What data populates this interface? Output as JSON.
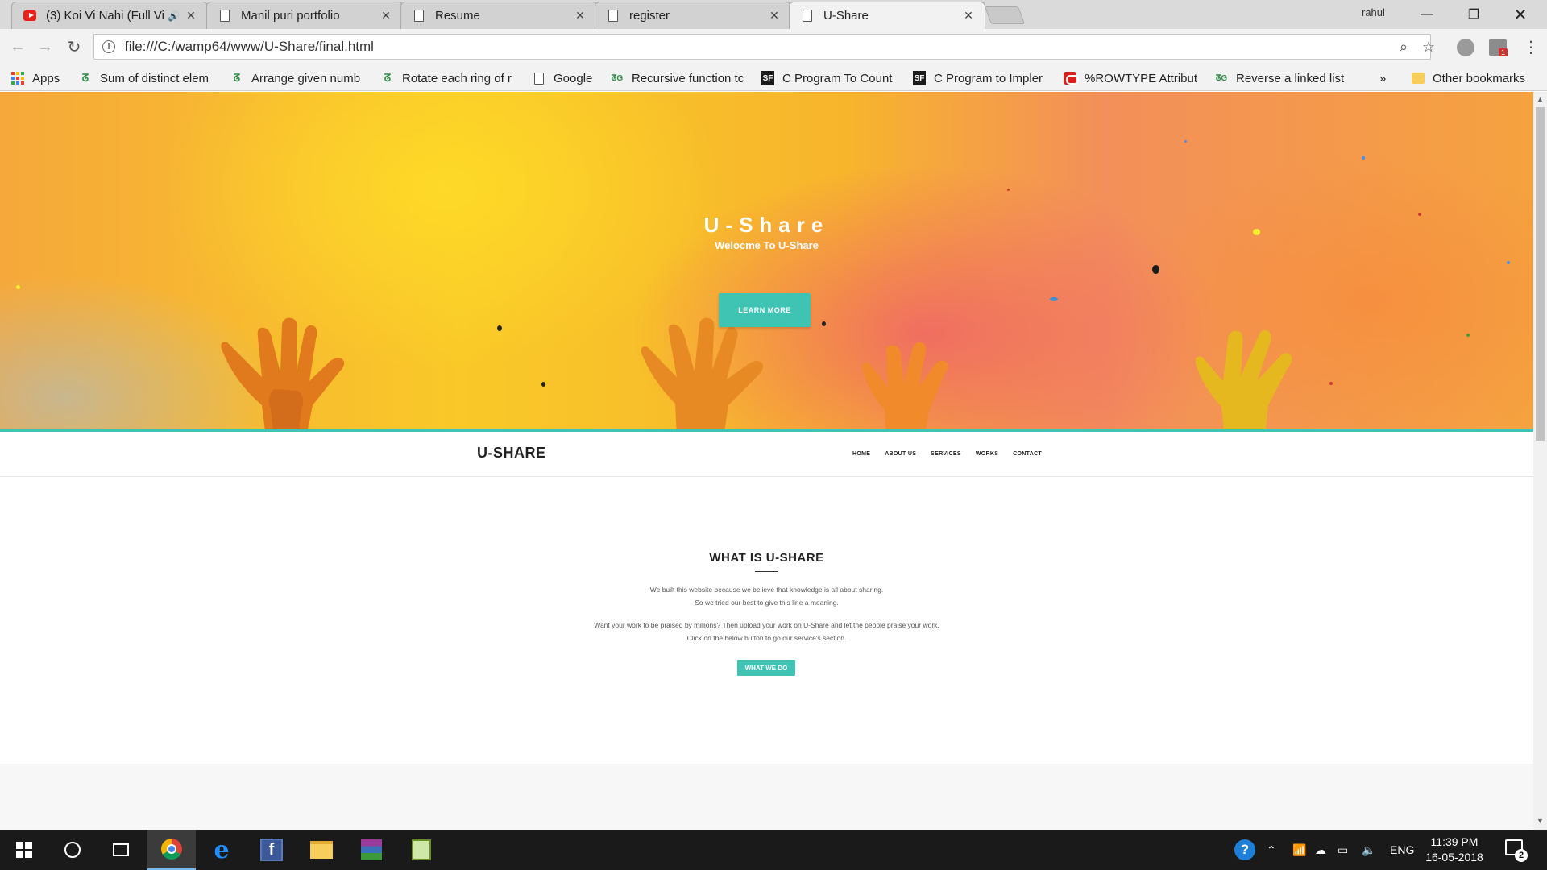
{
  "browser": {
    "tabs": [
      {
        "title": "(3) Koi Vi Nahi (Full Vi",
        "icon": "youtube-icon",
        "audio": "🔊"
      },
      {
        "title": "Manil puri portfolio",
        "icon": "page-icon"
      },
      {
        "title": "Resume",
        "icon": "page-icon"
      },
      {
        "title": "register",
        "icon": "page-icon"
      },
      {
        "title": "U-Share",
        "icon": "page-icon",
        "active": true
      }
    ],
    "profile_name": "rahul",
    "url": "file:///C:/wamp64/www/U-Share/final.html",
    "bookmarks": [
      {
        "label": "Apps",
        "icon": "apps-grid-icon"
      },
      {
        "label": "Sum of distinct elem",
        "icon": "geeksforgeeks-icon"
      },
      {
        "label": "Arrange given numb",
        "icon": "geeksforgeeks-icon"
      },
      {
        "label": "Rotate each ring of r",
        "icon": "geeksforgeeks-icon"
      },
      {
        "label": "Google",
        "icon": "page-icon"
      },
      {
        "label": "Recursive function tc",
        "icon": "geeksforgeeks-icon"
      },
      {
        "label": "C Program To Count",
        "icon": "sanfoundry-icon"
      },
      {
        "label": "C Program to Impler",
        "icon": "sanfoundry-icon"
      },
      {
        "label": "%ROWTYPE Attribut",
        "icon": "oracle-icon"
      },
      {
        "label": "Reverse a linked list",
        "icon": "geeksforgeeks-icon"
      }
    ],
    "bookmarks_overflow": "»",
    "other_bookmarks": "Other bookmarks",
    "extension_badge": "1"
  },
  "page": {
    "hero": {
      "title": "U-Share",
      "subtitle": "Welocme To U-Share",
      "button": "LEARN MORE"
    },
    "nav": {
      "brand": "U-SHARE",
      "links": [
        "HOME",
        "ABOUT US",
        "SERVICES",
        "WORKS",
        "CONTACT"
      ]
    },
    "about": {
      "heading": "WHAT IS U-SHARE",
      "line1": "We built this website because we believe that knowledge is all about sharing.",
      "line2": "So we tried our best to give this line a meaning.",
      "line3": "Want your work to be praised by millions? Then upload your work on U-Share and let the people praise your work.",
      "line4": "Click on the below button to go our service's section.",
      "button": "WHAT WE DO"
    },
    "accent_color": "#3fc4b4"
  },
  "taskbar": {
    "language": "ENG",
    "time": "11:39 PM",
    "date": "16-05-2018",
    "notification_count": "2"
  }
}
